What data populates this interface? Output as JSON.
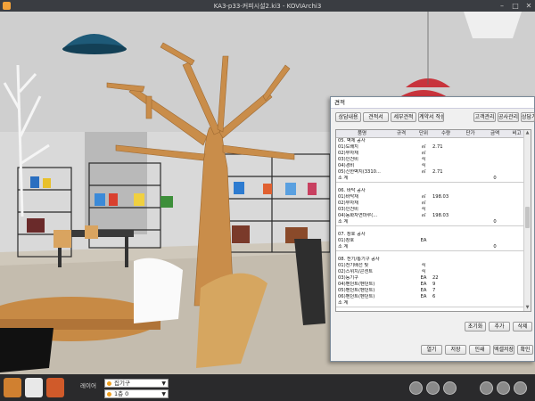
{
  "window": {
    "title": "KA3-p33-커피시설2.ki3 - KOVIArchi3"
  },
  "bottom": {
    "layer_label": "레이어",
    "furniture_combo": "집기구",
    "floor_combo": "1층 0"
  },
  "dialog": {
    "title": "견적",
    "top_buttons": [
      "상담내용",
      "견적서",
      "세부견적",
      "계약서 작성",
      "고객관리",
      "공사관리",
      "상담기록"
    ],
    "columns": [
      "품명",
      "규격",
      "단위",
      "수량",
      "단가",
      "금액",
      "비고"
    ],
    "rows": [
      {
        "name": "05. 벽체 공사",
        "unit": "",
        "qty": "",
        "amount": ""
      },
      {
        "name": "01)도배지",
        "unit": "㎡",
        "qty": "2.71",
        "amount": ""
      },
      {
        "name": "02)부자재",
        "unit": "㎡",
        "qty": "",
        "amount": ""
      },
      {
        "name": "03)인건비",
        "unit": "식",
        "qty": "",
        "amount": ""
      },
      {
        "name": "04)경비",
        "unit": "식",
        "qty": "",
        "amount": ""
      },
      {
        "name": "05)신한벽지(3310...",
        "unit": "㎡",
        "qty": "2.71",
        "amount": ""
      },
      {
        "name": "소 계",
        "unit": "",
        "qty": "",
        "amount": "0",
        "sum": true
      },
      {
        "name": "",
        "unit": "",
        "qty": "",
        "amount": ""
      },
      {
        "name": "06. 바닥 공사",
        "unit": "",
        "qty": "",
        "amount": ""
      },
      {
        "name": "01)바닥재",
        "unit": "㎡",
        "qty": "198.03",
        "amount": ""
      },
      {
        "name": "02)부자재",
        "unit": "㎡",
        "qty": "",
        "amount": ""
      },
      {
        "name": "03)인건비",
        "unit": "식",
        "qty": "",
        "amount": ""
      },
      {
        "name": "04)동화자연마루(...",
        "unit": "㎡",
        "qty": "198.03",
        "amount": ""
      },
      {
        "name": "소 계",
        "unit": "",
        "qty": "",
        "amount": "0",
        "sum": true
      },
      {
        "name": "",
        "unit": "",
        "qty": "",
        "amount": ""
      },
      {
        "name": "07. 창호 공사",
        "unit": "",
        "qty": "",
        "amount": ""
      },
      {
        "name": "01)창호",
        "unit": "EA",
        "qty": "",
        "amount": ""
      },
      {
        "name": "소 계",
        "unit": "",
        "qty": "",
        "amount": "0",
        "sum": true
      },
      {
        "name": "",
        "unit": "",
        "qty": "",
        "amount": ""
      },
      {
        "name": "08. 전기/통기구 공사",
        "unit": "",
        "qty": "",
        "amount": ""
      },
      {
        "name": "01)전기배선 및",
        "unit": "식",
        "qty": "",
        "amount": ""
      },
      {
        "name": "02)스위치/콘센트",
        "unit": "식",
        "qty": "",
        "amount": ""
      },
      {
        "name": "03)등기구",
        "unit": "EA",
        "qty": "22",
        "amount": ""
      },
      {
        "name": "04)펜던트(펜던트)",
        "unit": "EA",
        "qty": "9",
        "amount": ""
      },
      {
        "name": "05)펜던트(펜던트)",
        "unit": "EA",
        "qty": "7",
        "amount": ""
      },
      {
        "name": "06)펜던트(펜던트)",
        "unit": "EA",
        "qty": "6",
        "amount": ""
      },
      {
        "name": "소 계",
        "unit": "",
        "qty": "",
        "amount": "",
        "sum": true
      }
    ],
    "row_buttons": [
      "초기화",
      "추가",
      "삭제"
    ],
    "bottom_buttons": [
      "열기",
      "저장",
      "인쇄",
      "엑셀저장",
      "확인"
    ]
  },
  "colors": {
    "dialog_border": "#7b8a99",
    "wood": "#c98d4a",
    "lamp_blue": "#1e5a78",
    "lamp_red": "#c8343c"
  }
}
